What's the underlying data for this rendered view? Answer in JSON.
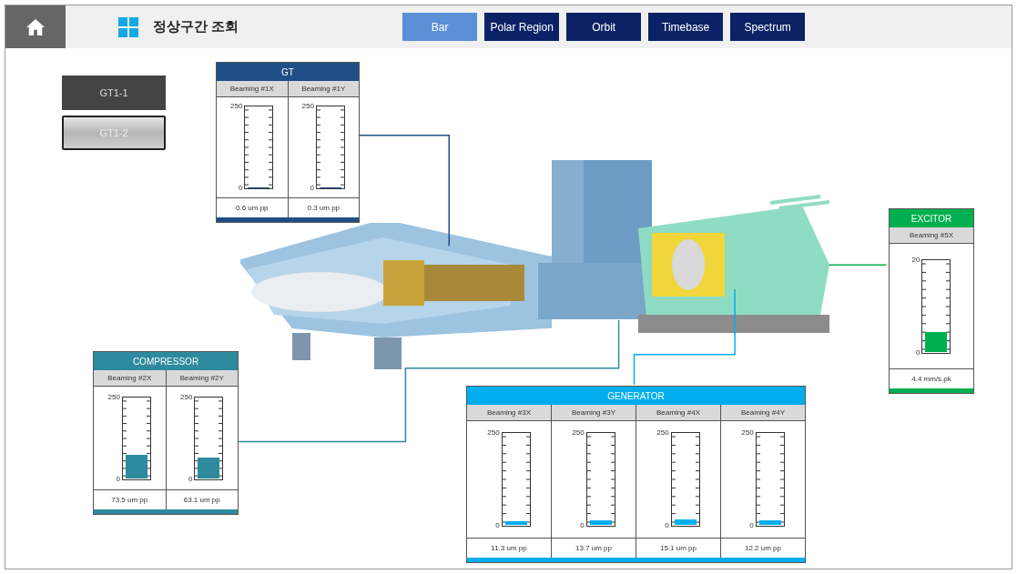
{
  "header": {
    "title": "정상구간 조회"
  },
  "tabs": [
    {
      "label": "Bar",
      "selected": true
    },
    {
      "label": "Polar Region",
      "selected": false
    },
    {
      "label": "Orbit",
      "selected": false
    },
    {
      "label": "Timebase",
      "selected": false
    },
    {
      "label": "Spectrum",
      "selected": false
    }
  ],
  "units": [
    {
      "label": "GT1-1",
      "selected": true
    },
    {
      "label": "GT1-2",
      "selected": false
    }
  ],
  "panels": [
    {
      "title": "GT",
      "color": "#1f4e86",
      "gauges": [
        {
          "label": "Beaming #1X",
          "scale_max": "250",
          "scale_min": "0",
          "level": 0.0024,
          "reading": "0.6 um pp"
        },
        {
          "label": "Beaming #1Y",
          "scale_max": "250",
          "scale_min": "0",
          "level": 0.0012,
          "reading": "0.3 um pp"
        }
      ]
    },
    {
      "title": "COMPRESSOR",
      "color": "#2e8a9e",
      "gauges": [
        {
          "label": "Beaming #2X",
          "scale_max": "250",
          "scale_min": "0",
          "level": 0.294,
          "reading": "73.5 um pp"
        },
        {
          "label": "Beaming #2Y",
          "scale_max": "250",
          "scale_min": "0",
          "level": 0.252,
          "reading": "63.1 um pp"
        }
      ]
    },
    {
      "title": "GENERATOR",
      "color": "#00aeef",
      "gauges": [
        {
          "label": "Beaming #3X",
          "scale_max": "250",
          "scale_min": "0",
          "level": 0.045,
          "reading": "11.3 um pp"
        },
        {
          "label": "Beaming #3Y",
          "scale_max": "250",
          "scale_min": "0",
          "level": 0.055,
          "reading": "13.7 um pp"
        },
        {
          "label": "Beaming #4X",
          "scale_max": "250",
          "scale_min": "0",
          "level": 0.06,
          "reading": "15.1 um pp"
        },
        {
          "label": "Beaming #4Y",
          "scale_max": "250",
          "scale_min": "0",
          "level": 0.049,
          "reading": "12.2 um pp"
        }
      ]
    },
    {
      "title": "EXCITOR",
      "color": "#00b050",
      "gauges": [
        {
          "label": "Beaming #5X",
          "scale_max": "20",
          "scale_min": "0",
          "level": 0.22,
          "reading": "4.4 mm/s.pk"
        }
      ]
    }
  ]
}
